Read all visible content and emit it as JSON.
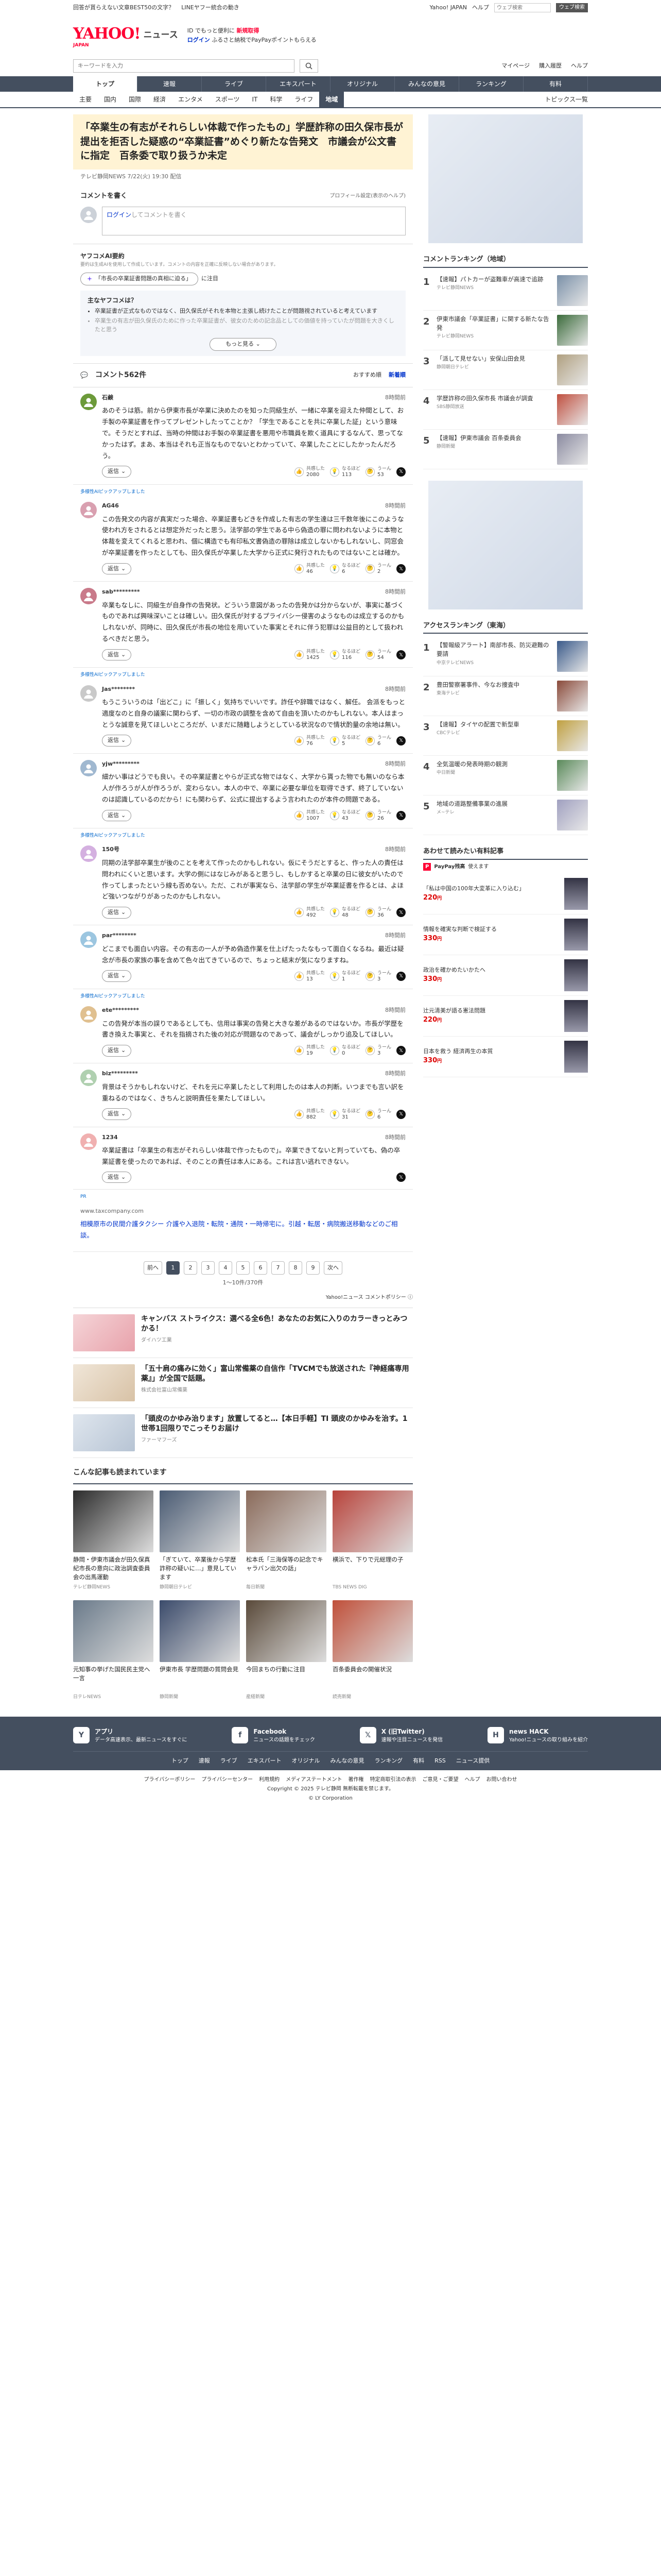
{
  "topbar": {
    "left_links": [
      "回答が貰らえない文章BEST50の文字？",
      "LINEヤフー統合の動き"
    ],
    "right_links": [
      "Yahoo! JAPAN",
      "ヘルプ"
    ],
    "search_placeholder": "ウェブ検索",
    "search_btn": "ウェブ検索"
  },
  "header": {
    "logo": "YAHOO!",
    "logo_sub": "JAPAN",
    "service": "ニュース",
    "promo_line1": "ID でもっと便利に",
    "promo_bold": "新規取得",
    "promo_login": "ログイン",
    "promo_line2": "ふるさと納税でPayPayポイントもらえる"
  },
  "search": {
    "placeholder": "キーワードを入力",
    "links": [
      "マイページ",
      "購入履歴",
      "ヘルプ"
    ]
  },
  "gnav": [
    "トップ",
    "速報",
    "ライブ",
    "エキスパート",
    "オリジナル",
    "みんなの意見",
    "ランキング",
    "有料"
  ],
  "subnav": {
    "items": [
      "主要",
      "国内",
      "国際",
      "経済",
      "エンタメ",
      "スポーツ",
      "IT",
      "科学",
      "ライフ",
      "地域"
    ],
    "active": "地域",
    "topics": "トピックス一覧"
  },
  "article": {
    "title": "「卒業生の有志がそれらしい体裁で作ったもの」学歴詐称の田久保市長が提出を拒否した疑惑の“卒業証書”めぐり新たな告発文　市議会が公文書に指定　百条委で取り扱うか未定",
    "source": "テレビ静岡NEWS",
    "date": "7/22(火) 19:30",
    "delivered": "配信"
  },
  "comment_form": {
    "heading": "コメントを書く",
    "note": "プロフィール設定(表示のヘルプ)",
    "login_link": "ログイン",
    "placeholder": "してコメントを書く"
  },
  "ai": {
    "heading": "ヤフコメAI要約",
    "disclaimer": "要約は生成AIを使用して作成しています。コメントの内容を正確に反映しない場合があります。",
    "chip": "「市長の卒業証書問題の真相に迫る」",
    "chip_suffix": "に注目",
    "box_title": "主なヤフコメは？",
    "points": [
      "卒業証書が正式なものではなく、田久保氏がそれを本物と主張し続けたことが問題視されていると考えています",
      "卒業生の有志が田久保氏のために作った卒業証書が、彼女のための記念品としての価値を持っていたが問題を大きくしたと思う"
    ],
    "more": "もっと見る"
  },
  "comments_head": {
    "title": "コメント562件",
    "sort_options": [
      "おすすめ順",
      "新着順"
    ],
    "sort_active": "新着順"
  },
  "comments": [
    {
      "user": "石鹸",
      "time": "8時間前",
      "badge": "",
      "text": "あのそうは筋。前から伊東市長が卒業に決めたのを知った同級生が、一緒に卒業を迎えた仲間として、お手製の卒業証書を作ってプレゼントしたってことか？「学生であることを共に卒業した証」という意味で。そうだとすれば、当時の仲間はお手製の卒業証書を悪用や市職員を欺く道具にするなんて、思ってなかったはず。まあ、本当はそれも正当なものでないとわかっていて、卒業したことにしたかったんだろう。",
      "r1": "2080",
      "r2": "113",
      "r3": "53"
    },
    {
      "user": "AG46",
      "time": "8時間前",
      "badge": "",
      "text": "この告発文の内容が真実だった場合、卒業証書もどきを作成した有志の学生達は三千数年後にこのような使われ方をされるとは想定外だったと思う。法学部の学生である中ら偽造の罪に問われないように本物と体裁を変えてくれると思われ、個に構造でも有印私文書偽造の罪除は成立しないかもしれないし、同窓会が卒業証書を作ったとしても、田久保氏が卒業した大学から正式に発行されたものではないことは確か。",
      "r1": "46",
      "r2": "6",
      "r3": "2"
    },
    {
      "user": "sab*********",
      "time": "8時間前",
      "badge": "",
      "text": "卒業もなしに、同級生が自身作の告発状。どういう意図があったの告発かは分からないが、事実に基づくものであれば興味深いことは確しい。田久保氏が対するプライバシー侵害のようなものは成立するのかもしれないが、同時に、田久保氏が市長の地位を用いていた事実とそれに伴う犯罪は公益目的として扱われるべきだと思う。",
      "r1": "1425",
      "r2": "116",
      "r3": "54"
    },
    {
      "user": "Jas********",
      "time": "8時間前",
      "badge": "",
      "text": "もうこういうのは「出どこ」に「振しく」気持ちでいいです。詐任や辞職ではなく、解任。 会派をもっと適度なのと自身の議案に関わらず、一切の市政の調整を含めて自由を頂いたのかもしれない。本人はまっとうな誠意を見てほしいところだが、いまだに随籍しようとしている状況なので情状酌量の余地は無い。",
      "r1": "76",
      "r2": "5",
      "r3": "6"
    },
    {
      "user": "yjw*********",
      "time": "8時間前",
      "badge": "",
      "text": "細かい事はどうでも良い。その卒業証書とやらが正式な物ではなく、大学から貰った物でも無いのなら本人が作ろうが人が作ろうが、変わらない。本人の中で、卒業に必要な単位を取得できず、終了していないのは認識しているのだから！にも関わらず、公式に提出するよう言われたのが本件の問題である。",
      "r1": "1007",
      "r2": "43",
      "r3": "26"
    },
    {
      "user": "150号",
      "time": "8時間前",
      "badge": "",
      "text": "同期の法学部卒業生が後のことを考えて作ったのかもしれない。仮にそうだとすると、作った人の責任は問われにくいと思います。大学の側にはなじみがあると思うし、もしかすると卒業の日に彼女がいたので作ってしまったという線も否めない。ただ、これが事実なら、法学部の学生が卒業証書を作るとは、よほど強いつながりがあったのかもしれない。",
      "r1": "492",
      "r2": "48",
      "r3": "36"
    },
    {
      "user": "par********",
      "time": "8時間前",
      "badge": "",
      "text": "どこまでも面白い内容。その有志の一人が予め偽造作業を仕上げたったなもって面白くなるね。最近は疑念が市長の家族の事を含めて色々出てきているので、ちょっと結末が気になりますね。",
      "r1": "13",
      "r2": "1",
      "r3": "3"
    },
    {
      "user": "ete*********",
      "time": "8時間前",
      "badge": "",
      "text": "この告発が本当の誤りであるとしても、信用は事実の告発と大きな差があるのではないか。市長が学歴を書き換えた事実と、それを指摘された後の対応が問題なのであって、議会がしっかり追及してほしい。",
      "r1": "19",
      "r2": "0",
      "r3": "3"
    },
    {
      "user": "biz*********",
      "time": "8時間前",
      "badge": "",
      "text": "背景はそうかもしれないけど、それを元に卒業したとして利用したのは本人の判断。いつまでも言い訳を重ねるのではなく、きちんと説明責任を果たしてほしい。",
      "r1": "882",
      "r2": "31",
      "r3": "6"
    },
    {
      "user": "1234",
      "time": "8時間前",
      "badge": "",
      "text": "卒業証書は「卒業生の有志がそれらしい体裁で作ったもので」。卒業できてないと判っていても、偽の卒業証書を使ったのであれば、そのことの責任は本人にある。これは言い逃れできない。",
      "r1": "",
      "r2": "",
      "r3": ""
    }
  ],
  "react_labels": [
    "共感した",
    "なるほど",
    "うーん"
  ],
  "reply_label": "返信",
  "expert_label": "多様性AIピックアップしました",
  "pr_ad": {
    "label": "PR",
    "url": "www.taxcompany.com",
    "text": "相模原市の民間介護タクシー 介護や入退院・転院・通院・一時帰宅に。引越・転居・病院搬送移動などのご相談。"
  },
  "pager": {
    "prev": "前へ",
    "pages": [
      "1",
      "2",
      "3",
      "4",
      "5",
      "6",
      "7",
      "8",
      "9"
    ],
    "next": "次へ",
    "note": "1〜10件/370件"
  },
  "policy": "Yahoo!ニュース コメントポリシー",
  "ads": [
    {
      "title": "キャンバス ストライクス：選べる全6色！あなたのお気に入りのカラーきっとみつかる！",
      "sponsor": "ダイハツ工業"
    },
    {
      "title": "「五十肩の痛みに効く」富山常備薬の自信作「TVCMでも放送された『神経痛専用薬』」が全国で話題。",
      "sponsor": "株式会社富山常備薬"
    },
    {
      "title": "「頭皮のかゆみ治ります」放置してると…【本日手軽】TI 頭皮のかゆみを治す。1世帯1回限りでこっそりお届け",
      "sponsor": "ファーマフーズ"
    }
  ],
  "recs": {
    "heading": "こんな記事も読まれています",
    "items": [
      {
        "title": "静岡・伊東市議会が田久保真紀市長の意向に政治調査委員会の出馬運動",
        "meta": "テレビ静岡NEWS"
      },
      {
        "title": "「ぎていて、卒業後から学歴詐称の疑いに…」意見しています",
        "meta": "静岡朝日テレビ"
      },
      {
        "title": "松本氏「三海保等の記念でキャラバン出欠の話」",
        "meta": "毎日新聞"
      },
      {
        "title": "横浜で、下りで元総理の子",
        "meta": "TBS NEWS DIG"
      },
      {
        "title": "元知事の挙げた国民民主党へ一言",
        "meta": "日テレNEWS"
      },
      {
        "title": "伊東市長 学歴問題の質問会見",
        "meta": "静岡新聞"
      },
      {
        "title": "今回まちの行動に注目",
        "meta": "産経新聞"
      },
      {
        "title": "百条委員会の開催状況",
        "meta": "読売新聞"
      }
    ]
  },
  "side": {
    "ranking_title": "コメントランキング（地域）",
    "ranking_more": "もっと見る",
    "ranking": [
      {
        "title": "【速報】パトカーが盗難車が高速で追跡",
        "meta": "テレビ静岡NEWS"
      },
      {
        "title": "伊東市議会「卒業証書」に関する新たな告発",
        "meta": "テレビ静岡NEWS"
      },
      {
        "title": "「派して見せない」安保山田会見",
        "meta": "静岡朝日テレビ"
      },
      {
        "title": "学歴詐称の田久保市長 市議会が調査",
        "meta": "SBS静岡放送"
      },
      {
        "title": "【速報】伊東市議会 百条委員会",
        "meta": "静岡新聞"
      }
    ],
    "access_title": "アクセスランキング（東海）",
    "access": [
      {
        "title": "【警報級アラート】南部市長、防災避難の要請",
        "meta": "中京テレビNEWS"
      },
      {
        "title": "豊田警察署事件、今なお捜査中",
        "meta": "東海テレビ"
      },
      {
        "title": "【速報】タイヤの配置で新型車",
        "meta": "CBCテレビ"
      },
      {
        "title": "全気温暖の発表時期の観測",
        "meta": "中日新聞"
      },
      {
        "title": "地域の道路整備事業の進展",
        "meta": "メ~テレ"
      }
    ],
    "books_title": "あわせて読みたい有料記事",
    "pp_label": "PayPay残高",
    "pp_text": "使えます",
    "books": [
      {
        "title": "「私は中国の100年大変革に入り込む」",
        "price": "220",
        "unit": "円"
      },
      {
        "title": "情報を確実な判断で検証する",
        "price": "330",
        "unit": "円"
      },
      {
        "title": "政治を確かめたいかたへ",
        "price": "330",
        "unit": "円"
      },
      {
        "title": "辻元清美が語る憲法問題",
        "price": "220",
        "unit": "円"
      },
      {
        "title": "日本を救う 経済再生の本質",
        "price": "330",
        "unit": "円"
      }
    ]
  },
  "footer": {
    "apps": [
      {
        "name": "アプリ",
        "desc": "データ高速表示、最新ニュースをすぐに"
      },
      {
        "name": "Facebook",
        "desc": "ニュースの話題をチェック"
      },
      {
        "name": "X (旧Twitter)",
        "desc": "速報や注目ニュースを発信"
      },
      {
        "name": "news HACK",
        "desc": "Yahoo!ニュースの取り組みを紹介"
      }
    ],
    "nav": [
      "トップ",
      "速報",
      "ライブ",
      "エキスパート",
      "オリジナル",
      "みんなの意見",
      "ランキング",
      "有料",
      "RSS",
      "ニュース提供"
    ],
    "links": [
      "プライバシーポリシー",
      "プライバシーセンター",
      "利用規約",
      "メディアステートメント",
      "著作権",
      "特定商取引法の表示",
      "ご意見・ご要望",
      "ヘルプ",
      "お問い合わせ"
    ],
    "copyright": "Copyright © 2025 テレビ静岡 無断転載を禁じます。",
    "copyright2": "© LY Corporation"
  },
  "colors": {
    "accent": "#ff0033",
    "nav": "#444f5f",
    "title_bg": "#fff3d4"
  }
}
